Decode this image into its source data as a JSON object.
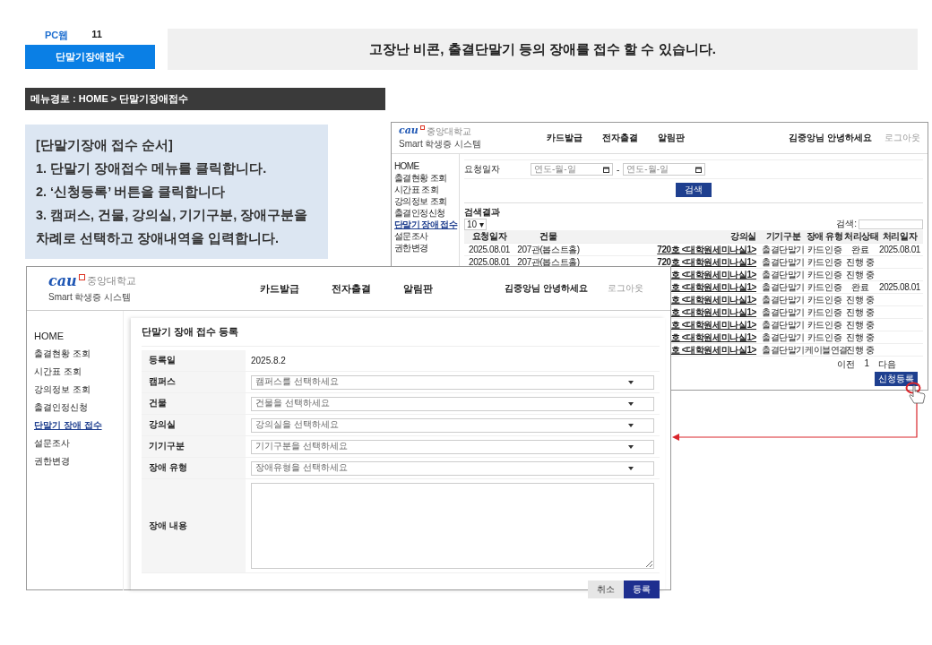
{
  "page": {
    "platform": "PC웹",
    "page_number": "11",
    "section_tab": "단말기장애접수",
    "headline": "고장난 비콘, 출결단말기 등의 장애를 접수 할 수 있습니다.",
    "menu_path": "메뉴경로 : HOME > 단말기장애접수"
  },
  "instructions": {
    "title": "[단말기장애 접수 순서]",
    "steps": [
      "1. 단말기 장애접수 메뉴를 클릭합니다.",
      "2. ‘신청등록’ 버튼을 클릭합니다",
      "3. 캠퍼스, 건물, 강의실, 기기구분, 장애구분을 차례로 선택하고 장애내역을 입력합니다."
    ]
  },
  "list_screen": {
    "logo": {
      "mark": "cau",
      "name": "중앙대학교",
      "system": "Smart 학생증 시스템"
    },
    "nav": [
      "카드발급",
      "전자출결",
      "알림판"
    ],
    "greeting": "김중앙님 안녕하세요",
    "logout": "로그아웃",
    "sidebar": [
      {
        "label": "HOME",
        "selected": false
      },
      {
        "label": "출결현황 조회",
        "selected": false
      },
      {
        "label": "시간표 조회",
        "selected": false
      },
      {
        "label": "강의정보 조회",
        "selected": false
      },
      {
        "label": "출결인정신청",
        "selected": false
      },
      {
        "label": "단말기 장애 접수",
        "selected": true
      },
      {
        "label": "설문조사",
        "selected": false
      },
      {
        "label": "권한변경",
        "selected": false
      }
    ],
    "filter": {
      "label": "요청일자",
      "date_from": {
        "placeholder": "연도-월-일"
      },
      "separator": "-",
      "date_to": {
        "placeholder": "연도-월-일"
      },
      "search_button": "검색"
    },
    "results_title": "검색결과",
    "page_size": "10 ▾",
    "search_label": "검색:",
    "table": {
      "columns": [
        "요청일자",
        "건물",
        "강의실",
        "기기구분",
        "장애 유형",
        "처리상태",
        "처리일자"
      ],
      "rows": [
        {
          "date": "2025.08.01",
          "building": "207관(봅스트홀)",
          "room": "720호 <대학원세미나실1>",
          "device": "출결단말기",
          "type": "카드인증",
          "status": "완료",
          "done_date": "2025.08.01"
        },
        {
          "date": "2025.08.01",
          "building": "207관(봅스트홀)",
          "room": "720호 <대학원세미나실1>",
          "device": "출결단말기",
          "type": "카드인증",
          "status": "진행 중"
        },
        {
          "room": "호 <대학원세미나실1>",
          "device": "출결단말기",
          "type": "카드인증",
          "status": "진행 중"
        },
        {
          "room": "호 <대학원세미나실1>",
          "device": "출결단말기",
          "type": "카드인증",
          "status": "완료",
          "done_date": "2025.08.01"
        },
        {
          "room": "호 <대학원세미나실1>",
          "device": "출결단말기",
          "type": "카드인증",
          "status": "진행 중"
        },
        {
          "room": "호 <대학원세미나실1>",
          "device": "출결단말기",
          "type": "카드인증",
          "status": "진행 중"
        },
        {
          "room": "호 <대학원세미나실1>",
          "device": "출결단말기",
          "type": "카드인증",
          "status": "진행 중"
        },
        {
          "room": "호 <대학원세미나실1>",
          "device": "출결단말기",
          "type": "카드인증",
          "status": "진행 중"
        },
        {
          "room": "호 <대학원세미나실1>",
          "device": "출결단말기",
          "type": "케이블연결",
          "status": "진행 중"
        }
      ]
    },
    "pagination": {
      "prev": "이전",
      "page": "1",
      "next": "다음"
    },
    "register_button": "신청등록"
  },
  "form_screen": {
    "logo": {
      "mark": "cau",
      "name": "중앙대학교",
      "system": "Smart 학생증 시스템"
    },
    "nav": [
      "카드발급",
      "전자출결",
      "알림판"
    ],
    "greeting": "김중앙님 안녕하세요",
    "logout": "로그아웃",
    "sidebar": [
      {
        "label": "HOME",
        "selected": false
      },
      {
        "label": "출결현황 조회",
        "selected": false
      },
      {
        "label": "시간표 조회",
        "selected": false
      },
      {
        "label": "강의정보 조회",
        "selected": false
      },
      {
        "label": "출결인정신청",
        "selected": false
      },
      {
        "label": "단말기 장애 접수",
        "selected": true
      },
      {
        "label": "설문조사",
        "selected": false
      },
      {
        "label": "권한변경",
        "selected": false
      }
    ],
    "form_title": "단말기 장애 접수 등록",
    "fields": [
      {
        "kind": "text",
        "label": "등록일",
        "value": "2025.8.2"
      },
      {
        "kind": "select",
        "label": "캠퍼스",
        "placeholder": "캠퍼스를 선택하세요"
      },
      {
        "kind": "select",
        "label": "건물",
        "placeholder": "건물을 선택하세요"
      },
      {
        "kind": "select",
        "label": "강의실",
        "placeholder": "강의실을 선택하세요"
      },
      {
        "kind": "select",
        "label": "기기구분",
        "placeholder": "기기구분을 선택하세요"
      },
      {
        "kind": "select",
        "label": "장애 유형",
        "placeholder": "장애유형을 선택하세요"
      },
      {
        "kind": "textarea",
        "label": "장애 내용"
      }
    ],
    "buttons": [
      {
        "kind": "secondary",
        "label": "취소"
      },
      {
        "kind": "primary",
        "label": "등록"
      }
    ]
  }
}
